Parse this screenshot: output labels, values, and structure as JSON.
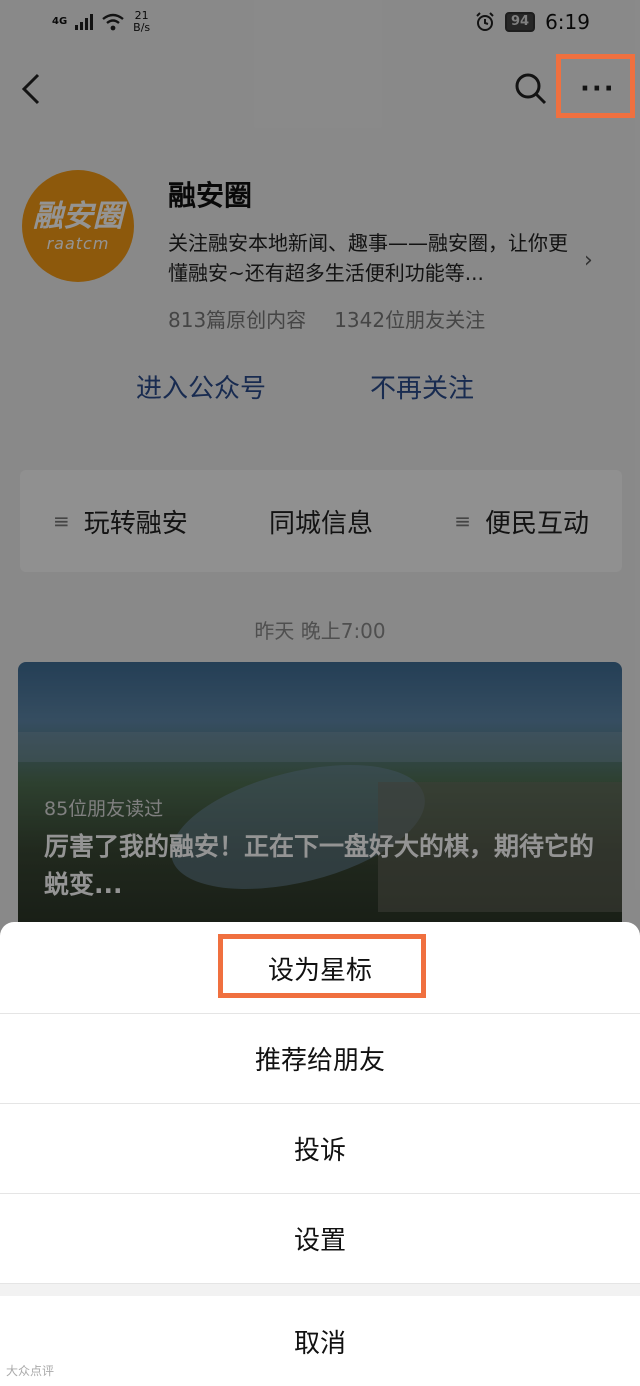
{
  "status_bar": {
    "network": "4G",
    "speed_value": "21",
    "speed_unit": "B/s",
    "battery": "94",
    "time": "6:19"
  },
  "account": {
    "logo_main": "融安圈",
    "logo_sub": "raatcm",
    "name": "融安圈",
    "description": "关注融安本地新闻、趣事——融安圈，让你更懂融安~还有超多生活便利功能等...",
    "original_count": "813篇原创内容",
    "followers": "1342位朋友关注"
  },
  "actions": {
    "enter": "进入公众号",
    "unfollow": "不再关注"
  },
  "menu": [
    {
      "label": "玩转融安",
      "has_icon": true
    },
    {
      "label": "同城信息",
      "has_icon": false
    },
    {
      "label": "便民互动",
      "has_icon": true
    }
  ],
  "post": {
    "time": "昨天 晚上7:00",
    "readers": "85位朋友读过",
    "title": "厉害了我的融安！正在下一盘好大的棋，期待它的蜕变..."
  },
  "sheet": {
    "items": [
      "设为星标",
      "推荐给朋友",
      "投诉",
      "设置"
    ],
    "cancel": "取消"
  },
  "watermark": "大众点评",
  "colors": {
    "highlight": "#f0703f",
    "link": "#2a4a8a",
    "logo": "#f39a16"
  }
}
